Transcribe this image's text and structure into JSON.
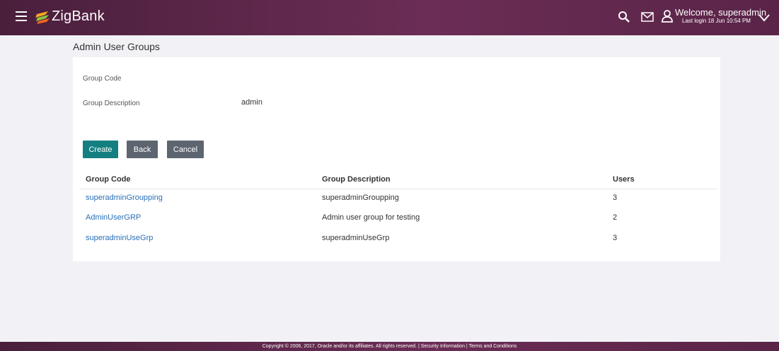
{
  "header": {
    "brand": "ZigBank",
    "welcome_text": "Welcome, superadmin",
    "last_login": "Last login 18 Jun 10:54 PM",
    "colors": {
      "bar": "#5a2448",
      "primary_button": "#147f80",
      "secondary_button": "#5d6570",
      "link": "#2a6fb8"
    }
  },
  "page": {
    "title": "Admin User Groups"
  },
  "form": {
    "group_code_label": "Group Code",
    "group_code_value": "",
    "group_description_label": "Group Description",
    "group_description_value": "admin"
  },
  "buttons": {
    "create": "Create",
    "back": "Back",
    "cancel": "Cancel"
  },
  "table": {
    "headers": [
      "Group Code",
      "Group Description",
      "Users"
    ],
    "rows": [
      {
        "code": "superadminGroupping",
        "description": "superadminGroupping",
        "users": "3"
      },
      {
        "code": "AdminUserGRP",
        "description": "Admin user group for testing",
        "users": "2"
      },
      {
        "code": "superadminUseGrp",
        "description": "superadminUseGrp",
        "users": "3"
      }
    ]
  },
  "footer": {
    "copyright": "Copyright © 2006, 2017, Oracle and/or its affiliates. All rights reserved.",
    "separator": " | ",
    "security_link": "Security Information",
    "terms_link": "Terms and Conditions"
  }
}
